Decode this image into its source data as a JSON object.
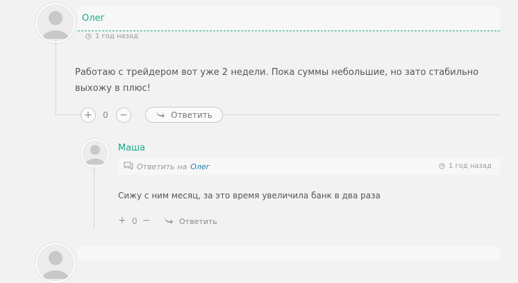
{
  "comment1": {
    "author": "Олег",
    "time": "1 год назад",
    "text": "Работаю с трейдером вот уже 2 недели. Пока суммы небольшие, но зато стабильно выхожу в плюс!",
    "vote_plus": "+",
    "vote_count": "0",
    "vote_minus": "−",
    "reply_label": "Ответить"
  },
  "comment2": {
    "author": "Маша",
    "reply_to_label": "Ответить на",
    "reply_to_name": "Олег",
    "time": "1 год назад",
    "text": "Сижу с ним месяц, за это время увеличила банк в два раза",
    "vote_plus": "+",
    "vote_count": "0",
    "vote_minus": "−",
    "reply_label": "Ответить"
  },
  "colors": {
    "accent": "#1aa98a",
    "link": "#1a7fa9",
    "background": "#f2f2f2"
  }
}
